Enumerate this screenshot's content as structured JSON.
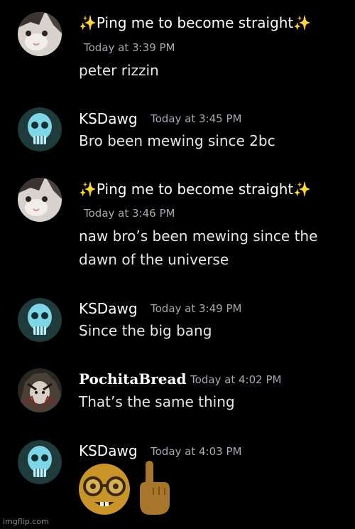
{
  "messages": [
    {
      "author": "✨Ping me to become straight✨",
      "time": "Today at 3:39 PM",
      "text": "peter rizzin",
      "avatar": "cat-avatar"
    },
    {
      "author": "KSDawg",
      "time": "Today at 3:45 PM",
      "text": "Bro been mewing since 2bc",
      "avatar": "skull-avatar"
    },
    {
      "author": "✨Ping me to become straight✨",
      "time": "Today at 3:46 PM",
      "text_lines": [
        "naw bro’s been mewing since the",
        "dawn of the universe"
      ],
      "avatar": "cat-avatar"
    },
    {
      "author": "KSDawg",
      "time": "Today at 3:49 PM",
      "text": "Since the big bang",
      "avatar": "skull-avatar"
    },
    {
      "author": "PochitaBread",
      "time": "Today at 4:02 PM",
      "text": "That’s the same thing",
      "avatar": "anime-avatar"
    },
    {
      "author": "KSDawg",
      "time": "Today at 4:03 PM",
      "emojis": [
        "nerd-face-icon",
        "pointing-up-icon"
      ],
      "avatar": "skull-avatar"
    }
  ],
  "watermark": "imgflip.com",
  "colors": {
    "background": "#000000",
    "timestamp": "#a6a9b0",
    "emoji_yellow": "#c9942a",
    "skin_tone": "#a8762a"
  }
}
